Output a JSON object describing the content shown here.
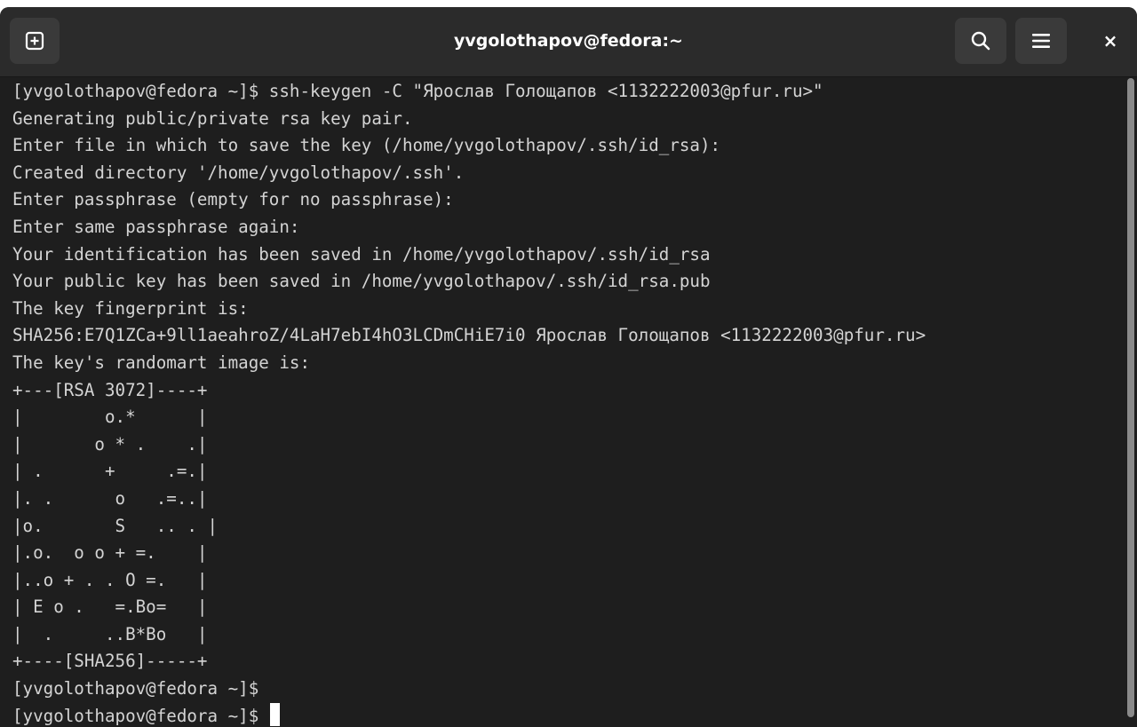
{
  "window": {
    "title": "yvgolothapov@fedora:~"
  },
  "icons": {
    "new_tab": "new-tab-icon",
    "search": "search-icon",
    "menu": "hamburger-menu-icon",
    "close": "close-icon"
  },
  "close_glyph": "×",
  "colors": {
    "background": "#1e1e1e",
    "titlebar": "#2b2b2b",
    "button": "#3a3a3a",
    "text": "#d4d4d4",
    "cursor": "#ffffff"
  },
  "terminal": {
    "lines": [
      "[yvgolothapov@fedora ~]$ ssh-keygen -C \"Ярослав Голощапов <1132222003@pfur.ru>\"",
      "Generating public/private rsa key pair.",
      "Enter file in which to save the key (/home/yvgolothapov/.ssh/id_rsa):",
      "Created directory '/home/yvgolothapov/.ssh'.",
      "Enter passphrase (empty for no passphrase):",
      "Enter same passphrase again:",
      "Your identification has been saved in /home/yvgolothapov/.ssh/id_rsa",
      "Your public key has been saved in /home/yvgolothapov/.ssh/id_rsa.pub",
      "The key fingerprint is:",
      "SHA256:E7Q1ZCa+9ll1aeahroZ/4LaH7ebI4hO3LCDmCHiE7i0 Ярослав Голощапов <1132222003@pfur.ru>",
      "The key's randomart image is:",
      "+---[RSA 3072]----+",
      "|        o.*      |",
      "|       o * .    .|",
      "| .      +     .=.|",
      "|. .      o   .=..|",
      "|o.       S   .. . |",
      "|.o.  o o + =.    |",
      "|..o + . . O =.   |",
      "| E o .   =.Bo=   |",
      "|  .     ..B*Bo   |",
      "+----[SHA256]-----+",
      "[yvgolothapov@fedora ~]$",
      "[yvgolothapov@fedora ~]$ "
    ]
  }
}
